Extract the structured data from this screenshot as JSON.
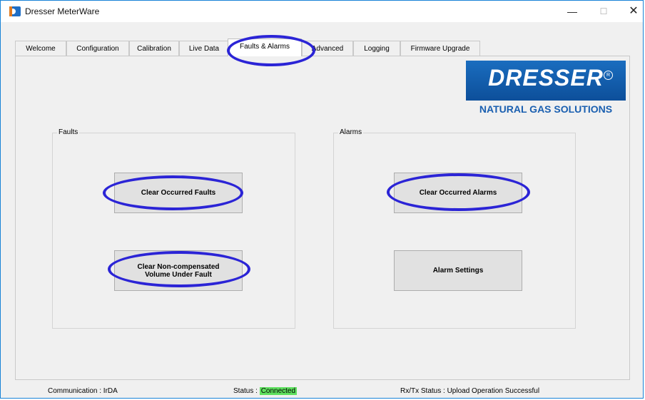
{
  "window": {
    "title": "Dresser MeterWare",
    "controls": {
      "minimize": "—",
      "maximize": "☐",
      "close": "✕"
    }
  },
  "tabs": [
    {
      "label": "Welcome",
      "active": false
    },
    {
      "label": "Configuration",
      "active": false
    },
    {
      "label": "Calibration",
      "active": false
    },
    {
      "label": "Live Data",
      "active": false
    },
    {
      "label": "Faults & Alarms",
      "active": true
    },
    {
      "label": "Advanced",
      "active": false
    },
    {
      "label": "Logging",
      "active": false
    },
    {
      "label": "Firmware Upgrade",
      "active": false
    }
  ],
  "logo": {
    "wordmark": "DRESSER",
    "registered": "R",
    "tagline": "NATURAL GAS SOLUTIONS"
  },
  "faults": {
    "label": "Faults",
    "clear_occurred": "Clear Occurred Faults",
    "clear_noncomp_line1": "Clear Non-compensated",
    "clear_noncomp_line2": "Volume Under Fault"
  },
  "alarms": {
    "label": "Alarms",
    "clear_occurred": "Clear Occurred Alarms",
    "settings": "Alarm Settings"
  },
  "status": {
    "communication": "Communication : IrDA",
    "status_label": "Status :",
    "status_value": "Connected",
    "rxtx": "Rx/Tx Status : Upload Operation Successful"
  },
  "colors": {
    "highlight": "#2b24d6",
    "connected": "#5fe05f",
    "brand_blue": "#1a6dbf"
  }
}
